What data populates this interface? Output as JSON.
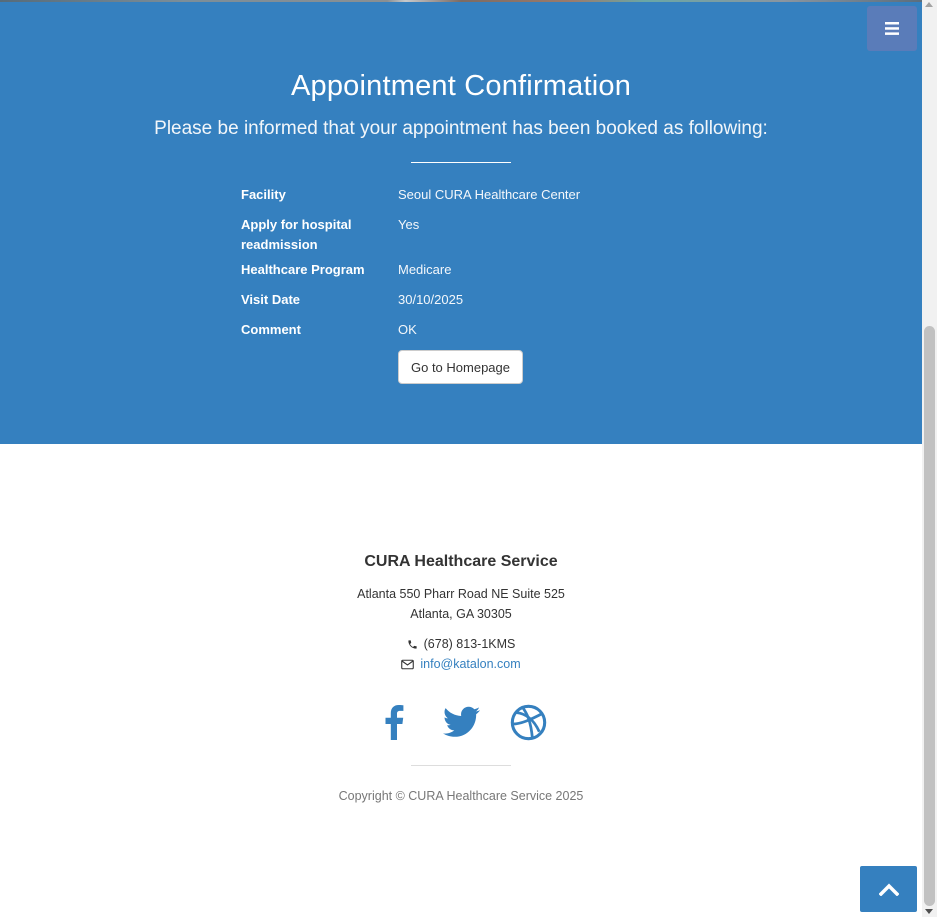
{
  "hero": {
    "title": "Appointment Confirmation",
    "subtitle": "Please be informed that your appointment has been booked as following:",
    "details": [
      {
        "label": "Facility",
        "value": "Seoul CURA Healthcare Center"
      },
      {
        "label": "Apply for hospital readmission",
        "value": "Yes"
      },
      {
        "label": "Healthcare Program",
        "value": "Medicare"
      },
      {
        "label": "Visit Date",
        "value": "30/10/2025"
      },
      {
        "label": "Comment",
        "value": "OK"
      }
    ],
    "home_button_label": "Go to Homepage"
  },
  "footer": {
    "brand": "CURA Healthcare Service",
    "address_line1": "Atlanta 550 Pharr Road NE Suite 525",
    "address_line2": "Atlanta, GA 30305",
    "phone": "(678) 813-1KMS",
    "email": "info@katalon.com",
    "copyright": "Copyright © CURA Healthcare Service 2025"
  },
  "icons": {
    "menu": "bars-icon",
    "phone": "phone-icon",
    "email": "envelope-icon",
    "facebook": "facebook-icon",
    "twitter": "twitter-icon",
    "dribbble": "dribbble-icon",
    "to_top": "chevron-up-icon"
  },
  "colors": {
    "primary": "#3580bf",
    "link": "#3580bf"
  }
}
